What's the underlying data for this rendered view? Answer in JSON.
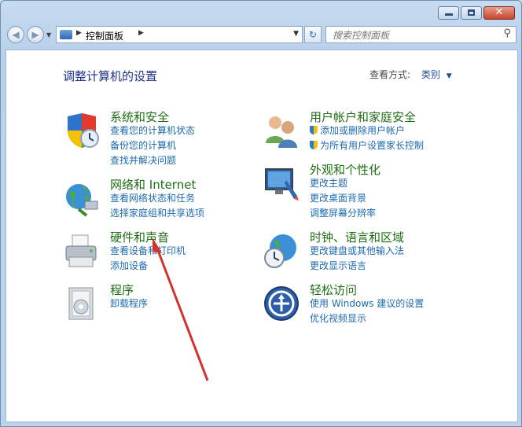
{
  "window": {
    "close_glyph": "✕"
  },
  "nav": {
    "back_glyph": "◀",
    "forward_glyph": "▶",
    "breadcrumb": "控制面板",
    "search_placeholder": "搜索控制面板",
    "refresh_glyph": "↻"
  },
  "page": {
    "title": "调整计算机的设置",
    "view_by_label": "查看方式:",
    "view_by_value": "类别"
  },
  "categories": [
    {
      "title": "系统和安全",
      "links": [
        "查看您的计算机状态",
        "备份您的计算机",
        "查找并解决问题"
      ]
    },
    {
      "title": "网络和 Internet",
      "links": [
        "查看网络状态和任务",
        "选择家庭组和共享选项"
      ]
    },
    {
      "title": "硬件和声音",
      "links": [
        "查看设备和打印机",
        "添加设备"
      ]
    },
    {
      "title": "程序",
      "links": [
        "卸载程序"
      ]
    },
    {
      "title": "用户帐户和家庭安全",
      "links": [
        "添加或删除用户帐户",
        "为所有用户设置家长控制"
      ]
    },
    {
      "title": "外观和个性化",
      "links": [
        "更改主题",
        "更改桌面背景",
        "调整屏幕分辨率"
      ]
    },
    {
      "title": "时钟、语言和区域",
      "links": [
        "更改键盘或其他输入法",
        "更改显示语言"
      ]
    },
    {
      "title": "轻松访问",
      "links": [
        "使用 Windows 建议的设置",
        "优化视频显示"
      ]
    }
  ],
  "colors": {
    "title_green": "#1e6e14",
    "link_blue": "#1e6ab0",
    "annotation_arrow": "#d0342c"
  }
}
